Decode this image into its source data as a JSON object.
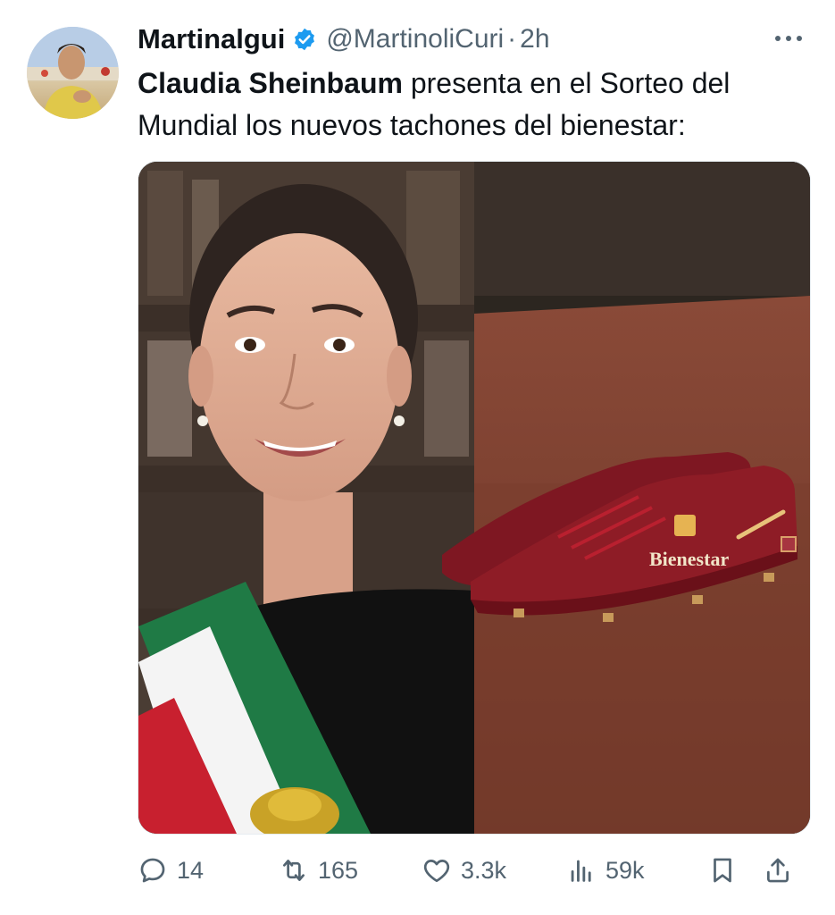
{
  "author": {
    "display_name": "Martinalgui",
    "handle": "@MartinoliCuri",
    "separator": "·",
    "timestamp": "2h",
    "verified_icon": "verified-badge-icon"
  },
  "tweet": {
    "text_bold": "Claudia Sheinbaum",
    "text_rest": " presenta en el Sorteo del Mundial los nuevos tachones del bienestar:"
  },
  "media": {
    "shoe_brand_text": "Bienestar"
  },
  "actions": {
    "replies": "14",
    "retweets": "165",
    "likes": "3.3k",
    "views": "59k"
  },
  "colors": {
    "text_primary": "#0f1419",
    "text_secondary": "#536471",
    "verified_blue": "#1d9bf0",
    "shoe_red": "#8e1c26"
  }
}
